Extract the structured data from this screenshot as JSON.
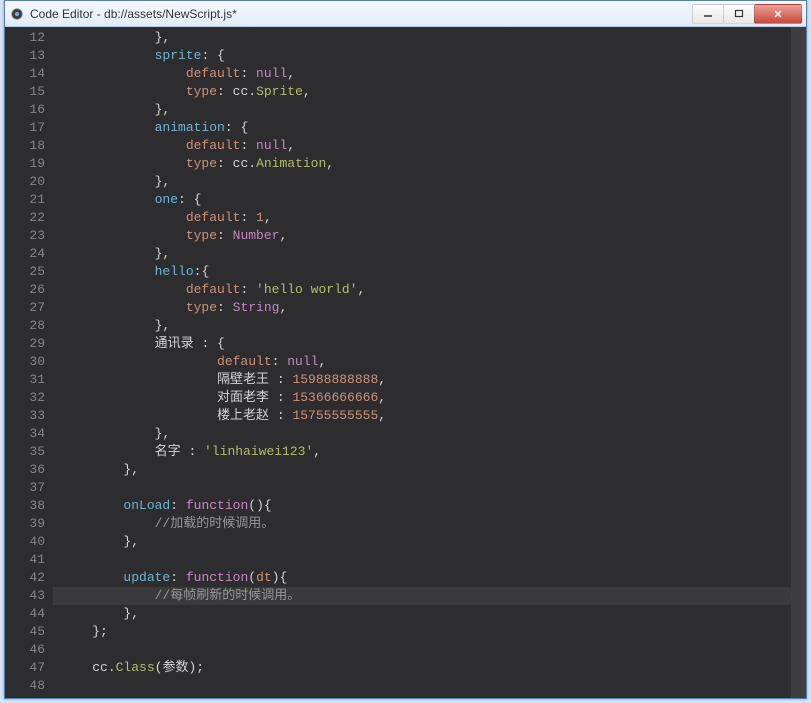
{
  "window": {
    "title": "Code Editor - db://assets/NewScript.js*"
  },
  "code": {
    "first_line": 12,
    "current_line": 43,
    "lines": [
      {
        "n": 12,
        "indent": 3,
        "tokens": [
          {
            "t": "},",
            "c": "punct"
          }
        ]
      },
      {
        "n": 13,
        "indent": 3,
        "tokens": [
          {
            "t": "sprite",
            "c": "key"
          },
          {
            "t": ": {",
            "c": "punct"
          }
        ]
      },
      {
        "n": 14,
        "indent": 4,
        "tokens": [
          {
            "t": "default",
            "c": "prop"
          },
          {
            "t": ": ",
            "c": "punct"
          },
          {
            "t": "null",
            "c": "null"
          },
          {
            "t": ",",
            "c": "punct"
          }
        ]
      },
      {
        "n": 15,
        "indent": 4,
        "tokens": [
          {
            "t": "type",
            "c": "prop"
          },
          {
            "t": ": cc.",
            "c": "punct"
          },
          {
            "t": "Sprite",
            "c": "type"
          },
          {
            "t": ",",
            "c": "punct"
          }
        ]
      },
      {
        "n": 16,
        "indent": 3,
        "tokens": [
          {
            "t": "},",
            "c": "punct"
          }
        ]
      },
      {
        "n": 17,
        "indent": 3,
        "tokens": [
          {
            "t": "animation",
            "c": "key"
          },
          {
            "t": ": {",
            "c": "punct"
          }
        ]
      },
      {
        "n": 18,
        "indent": 4,
        "tokens": [
          {
            "t": "default",
            "c": "prop"
          },
          {
            "t": ": ",
            "c": "punct"
          },
          {
            "t": "null",
            "c": "null"
          },
          {
            "t": ",",
            "c": "punct"
          }
        ]
      },
      {
        "n": 19,
        "indent": 4,
        "tokens": [
          {
            "t": "type",
            "c": "prop"
          },
          {
            "t": ": cc.",
            "c": "punct"
          },
          {
            "t": "Animation",
            "c": "type"
          },
          {
            "t": ",",
            "c": "punct"
          }
        ]
      },
      {
        "n": 20,
        "indent": 3,
        "tokens": [
          {
            "t": "},",
            "c": "punct"
          }
        ]
      },
      {
        "n": 21,
        "indent": 3,
        "tokens": [
          {
            "t": "one",
            "c": "key"
          },
          {
            "t": ": {",
            "c": "punct"
          }
        ]
      },
      {
        "n": 22,
        "indent": 4,
        "tokens": [
          {
            "t": "default",
            "c": "prop"
          },
          {
            "t": ": ",
            "c": "punct"
          },
          {
            "t": "1",
            "c": "num"
          },
          {
            "t": ",",
            "c": "punct"
          }
        ]
      },
      {
        "n": 23,
        "indent": 4,
        "tokens": [
          {
            "t": "type",
            "c": "prop"
          },
          {
            "t": ": ",
            "c": "punct"
          },
          {
            "t": "Number",
            "c": "null"
          },
          {
            "t": ",",
            "c": "punct"
          }
        ]
      },
      {
        "n": 24,
        "indent": 3,
        "tokens": [
          {
            "t": "},",
            "c": "punct"
          }
        ]
      },
      {
        "n": 25,
        "indent": 3,
        "tokens": [
          {
            "t": "hello",
            "c": "key"
          },
          {
            "t": ":{",
            "c": "punct"
          }
        ]
      },
      {
        "n": 26,
        "indent": 4,
        "tokens": [
          {
            "t": "default",
            "c": "prop"
          },
          {
            "t": ": ",
            "c": "punct"
          },
          {
            "t": "'hello world'",
            "c": "str"
          },
          {
            "t": ",",
            "c": "punct"
          }
        ]
      },
      {
        "n": 27,
        "indent": 4,
        "tokens": [
          {
            "t": "type",
            "c": "prop"
          },
          {
            "t": ": ",
            "c": "punct"
          },
          {
            "t": "String",
            "c": "null"
          },
          {
            "t": ",",
            "c": "punct"
          }
        ]
      },
      {
        "n": 28,
        "indent": 3,
        "tokens": [
          {
            "t": "},",
            "c": "punct"
          }
        ]
      },
      {
        "n": 29,
        "indent": 3,
        "tokens": [
          {
            "t": "通讯录 ",
            "c": "ident"
          },
          {
            "t": ": {",
            "c": "punct"
          }
        ]
      },
      {
        "n": 30,
        "indent": 5,
        "tokens": [
          {
            "t": "default",
            "c": "prop"
          },
          {
            "t": ": ",
            "c": "punct"
          },
          {
            "t": "null",
            "c": "null"
          },
          {
            "t": ",",
            "c": "punct"
          }
        ]
      },
      {
        "n": 31,
        "indent": 5,
        "tokens": [
          {
            "t": "隔壁老王 ",
            "c": "ident"
          },
          {
            "t": ": ",
            "c": "punct"
          },
          {
            "t": "15988888888",
            "c": "num"
          },
          {
            "t": ",",
            "c": "punct"
          }
        ]
      },
      {
        "n": 32,
        "indent": 5,
        "tokens": [
          {
            "t": "对面老李 ",
            "c": "ident"
          },
          {
            "t": ": ",
            "c": "punct"
          },
          {
            "t": "15366666666",
            "c": "num"
          },
          {
            "t": ",",
            "c": "punct"
          }
        ]
      },
      {
        "n": 33,
        "indent": 5,
        "tokens": [
          {
            "t": "楼上老赵 ",
            "c": "ident"
          },
          {
            "t": ": ",
            "c": "punct"
          },
          {
            "t": "15755555555",
            "c": "num"
          },
          {
            "t": ",",
            "c": "punct"
          }
        ]
      },
      {
        "n": 34,
        "indent": 3,
        "tokens": [
          {
            "t": "},",
            "c": "punct"
          }
        ]
      },
      {
        "n": 35,
        "indent": 3,
        "tokens": [
          {
            "t": "名字 ",
            "c": "ident"
          },
          {
            "t": ": ",
            "c": "punct"
          },
          {
            "t": "'linhaiwei123'",
            "c": "str"
          },
          {
            "t": ",",
            "c": "punct"
          }
        ]
      },
      {
        "n": 36,
        "indent": 2,
        "tokens": [
          {
            "t": "},",
            "c": "punct"
          }
        ]
      },
      {
        "n": 37,
        "indent": 0,
        "tokens": []
      },
      {
        "n": 38,
        "indent": 2,
        "tokens": [
          {
            "t": "onLoad",
            "c": "key"
          },
          {
            "t": ": ",
            "c": "punct"
          },
          {
            "t": "function",
            "c": "func"
          },
          {
            "t": "(){",
            "c": "punct"
          }
        ]
      },
      {
        "n": 39,
        "indent": 3,
        "tokens": [
          {
            "t": "//加载的时候调用。",
            "c": "comment"
          }
        ]
      },
      {
        "n": 40,
        "indent": 2,
        "tokens": [
          {
            "t": "},",
            "c": "punct"
          }
        ]
      },
      {
        "n": 41,
        "indent": 0,
        "tokens": []
      },
      {
        "n": 42,
        "indent": 2,
        "tokens": [
          {
            "t": "update",
            "c": "key"
          },
          {
            "t": ": ",
            "c": "punct"
          },
          {
            "t": "function",
            "c": "func"
          },
          {
            "t": "(",
            "c": "punct"
          },
          {
            "t": "dt",
            "c": "param"
          },
          {
            "t": "){",
            "c": "punct"
          }
        ]
      },
      {
        "n": 43,
        "indent": 3,
        "tokens": [
          {
            "t": "//每帧刷新的时候调用。",
            "c": "comment"
          }
        ]
      },
      {
        "n": 44,
        "indent": 2,
        "tokens": [
          {
            "t": "},",
            "c": "punct"
          }
        ]
      },
      {
        "n": 45,
        "indent": 1,
        "tokens": [
          {
            "t": "};",
            "c": "punct"
          }
        ]
      },
      {
        "n": 46,
        "indent": 0,
        "tokens": []
      },
      {
        "n": 47,
        "indent": 1,
        "tokens": [
          {
            "t": "cc.",
            "c": "ident"
          },
          {
            "t": "Class",
            "c": "type"
          },
          {
            "t": "(参数);",
            "c": "punct"
          }
        ]
      },
      {
        "n": 48,
        "indent": 0,
        "tokens": []
      }
    ]
  }
}
